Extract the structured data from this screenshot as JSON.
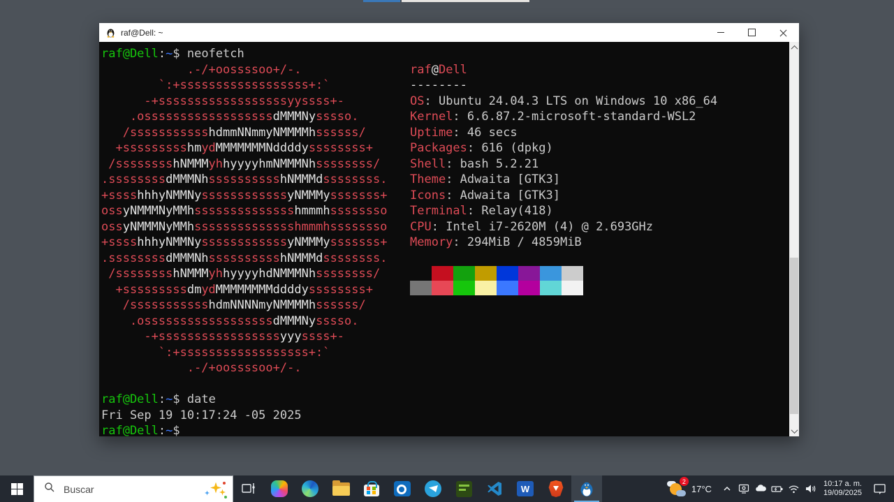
{
  "desktop": {
    "bg": "#4c5259",
    "background_window_edges": [
      {
        "name": "blue-tab-edge",
        "color": "#3a78b8"
      },
      {
        "name": "light-window-edge",
        "color": "#e6e4e1"
      }
    ]
  },
  "terminal": {
    "title": "raf@Dell: ~",
    "window_controls": [
      "minimize",
      "maximize",
      "close"
    ],
    "colors": {
      "background": "#0c0c0c",
      "red": "#de4b56",
      "white": "#e4e4e4",
      "default": "#cccccc",
      "green": "#16c60c",
      "blue": "#3b78ff"
    },
    "prompt": [
      {
        "c": "g",
        "t": "raf@Dell"
      },
      {
        "c": "def",
        "t": ":"
      },
      {
        "c": "b",
        "t": "~"
      },
      {
        "c": "def",
        "t": "$"
      }
    ],
    "commands": {
      "first": "neofetch",
      "second": "date"
    },
    "date_output": "Fri Sep 19 10:17:24 -05 2025",
    "ascii_art": [
      [
        [
          "r",
          "            .-/+oossssoo+/-."
        ]
      ],
      [
        [
          "r",
          "        `:+ssssssssssssssssss+:`"
        ]
      ],
      [
        [
          "r",
          "      -+ssssssssssssssssssyyssss+-"
        ]
      ],
      [
        [
          "r",
          "    .ossssssssssssssssss"
        ],
        [
          "w",
          "dMMMNy"
        ],
        [
          "r",
          "sssso."
        ]
      ],
      [
        [
          "r",
          "   /sssssssssss"
        ],
        [
          "w",
          "hdmmNNmmyNMMMMh"
        ],
        [
          "r",
          "ssssss/"
        ]
      ],
      [
        [
          "r",
          "  +sssssssss"
        ],
        [
          "w",
          "hm"
        ],
        [
          "r",
          "yd"
        ],
        [
          "w",
          "MMMMMMMNddddy"
        ],
        [
          "r",
          "ssssssss+"
        ]
      ],
      [
        [
          "r",
          " /ssssssss"
        ],
        [
          "w",
          "hNMMM"
        ],
        [
          "r",
          "yh"
        ],
        [
          "w",
          "hyyyyhmNMMMNh"
        ],
        [
          "r",
          "ssssssss/"
        ]
      ],
      [
        [
          "r",
          ".ssssssss"
        ],
        [
          "w",
          "dMMMNh"
        ],
        [
          "r",
          "ssssssssss"
        ],
        [
          "w",
          "hNMMMd"
        ],
        [
          "r",
          "ssssssss."
        ]
      ],
      [
        [
          "r",
          "+ssss"
        ],
        [
          "w",
          "hhhyNMMNy"
        ],
        [
          "r",
          "ssssssssssss"
        ],
        [
          "w",
          "yNMMMy"
        ],
        [
          "r",
          "sssssss+"
        ]
      ],
      [
        [
          "r",
          "oss"
        ],
        [
          "w",
          "yNMMMNyMMh"
        ],
        [
          "r",
          "ssssssssssssss"
        ],
        [
          "w",
          "hmmmh"
        ],
        [
          "r",
          "ssssssso"
        ]
      ],
      [
        [
          "r",
          "oss"
        ],
        [
          "w",
          "yNMMMNyMMh"
        ],
        [
          "r",
          "sssssssssssssshmmmhssssssso"
        ]
      ],
      [
        [
          "r",
          "+ssss"
        ],
        [
          "w",
          "hhhyNMMNy"
        ],
        [
          "r",
          "ssssssssssss"
        ],
        [
          "w",
          "yNMMMy"
        ],
        [
          "r",
          "sssssss+"
        ]
      ],
      [
        [
          "r",
          ".ssssssss"
        ],
        [
          "w",
          "dMMMNh"
        ],
        [
          "r",
          "ssssssssss"
        ],
        [
          "w",
          "hNMMMd"
        ],
        [
          "r",
          "ssssssss."
        ]
      ],
      [
        [
          "r",
          " /ssssssss"
        ],
        [
          "w",
          "hNMMM"
        ],
        [
          "r",
          "yh"
        ],
        [
          "w",
          "hyyyyhdNMMMNh"
        ],
        [
          "r",
          "ssssssss/"
        ]
      ],
      [
        [
          "r",
          "  +sssssssss"
        ],
        [
          "w",
          "dm"
        ],
        [
          "r",
          "yd"
        ],
        [
          "w",
          "MMMMMMMMddddy"
        ],
        [
          "r",
          "ssssssss+"
        ]
      ],
      [
        [
          "r",
          "   /sssssssssss"
        ],
        [
          "w",
          "hdmNNNNmyNMMMMh"
        ],
        [
          "r",
          "ssssss/"
        ]
      ],
      [
        [
          "r",
          "    .ossssssssssssssssss"
        ],
        [
          "w",
          "dMMMNy"
        ],
        [
          "r",
          "sssso."
        ]
      ],
      [
        [
          "r",
          "      -+sssssssssssssssss"
        ],
        [
          "w",
          "yyy"
        ],
        [
          "r",
          "ssss+-"
        ]
      ],
      [
        [
          "r",
          "        `:+ssssssssssssssssss+:`"
        ]
      ],
      [
        [
          "r",
          "            .-/+oossssoo+/-."
        ]
      ]
    ],
    "info": {
      "title": [
        {
          "c": "r",
          "t": "raf"
        },
        {
          "c": "w",
          "t": "@"
        },
        {
          "c": "r",
          "t": "Dell"
        }
      ],
      "underline": "--------",
      "separator": ": ",
      "rows": [
        {
          "label": "OS",
          "value": "Ubuntu 24.04.3 LTS on Windows 10 x86_64"
        },
        {
          "label": "Kernel",
          "value": "6.6.87.2-microsoft-standard-WSL2"
        },
        {
          "label": "Uptime",
          "value": "46 secs"
        },
        {
          "label": "Packages",
          "value": "616 (dpkg)"
        },
        {
          "label": "Shell",
          "value": "bash 5.2.21"
        },
        {
          "label": "Theme",
          "value": "Adwaita [GTK3]"
        },
        {
          "label": "Icons",
          "value": "Adwaita [GTK3]"
        },
        {
          "label": "Terminal",
          "value": "Relay(418)"
        },
        {
          "label": "CPU",
          "value": "Intel i7-2620M (4) @ 2.693GHz"
        },
        {
          "label": "Memory",
          "value": "294MiB / 4859MiB"
        }
      ],
      "palette_row1": [
        "#0c0c0c",
        "#c50f1f",
        "#13a10e",
        "#c19c00",
        "#0037da",
        "#881798",
        "#3a96dd",
        "#cccccc"
      ],
      "palette_row2": [
        "#767676",
        "#e74856",
        "#16c60c",
        "#f9f1a5",
        "#3b78ff",
        "#b4009e",
        "#61d6d6",
        "#f2f2f2"
      ]
    }
  },
  "taskbar": {
    "bg": "#242931",
    "search": {
      "placeholder": "Buscar"
    },
    "apps": [
      {
        "id": "task-view",
        "name": "task-view-button"
      },
      {
        "id": "copilot",
        "name": "copilot-icon"
      },
      {
        "id": "edge",
        "name": "edge-icon"
      },
      {
        "id": "file-explorer",
        "name": "file-explorer-icon"
      },
      {
        "id": "store",
        "name": "microsoft-store-icon"
      },
      {
        "id": "outlook",
        "name": "outlook-icon"
      },
      {
        "id": "telegram",
        "name": "telegram-icon"
      },
      {
        "id": "reader",
        "name": "green-reader-app-icon"
      },
      {
        "id": "vscode",
        "name": "vscode-icon"
      },
      {
        "id": "word",
        "name": "word-icon"
      },
      {
        "id": "brave",
        "name": "brave-icon"
      },
      {
        "id": "wsl-terminal",
        "name": "wsl-terminal-icon",
        "active": true
      }
    ],
    "icon_glyphs": {
      "word_letter": "W"
    },
    "tray": {
      "weather": {
        "temp": "17°C",
        "badge": "2"
      },
      "icons": [
        {
          "id": "chevron-up",
          "name": "tray-chevron-up-icon"
        },
        {
          "id": "wireless-display",
          "name": "wireless-display-icon"
        },
        {
          "id": "onedrive",
          "name": "onedrive-cloud-icon"
        },
        {
          "id": "battery",
          "name": "battery-icon"
        },
        {
          "id": "network",
          "name": "network-wifi-icon"
        },
        {
          "id": "volume",
          "name": "volume-icon"
        }
      ],
      "clock": {
        "time": "10:17 a. m.",
        "date": "19/09/2025"
      }
    }
  }
}
